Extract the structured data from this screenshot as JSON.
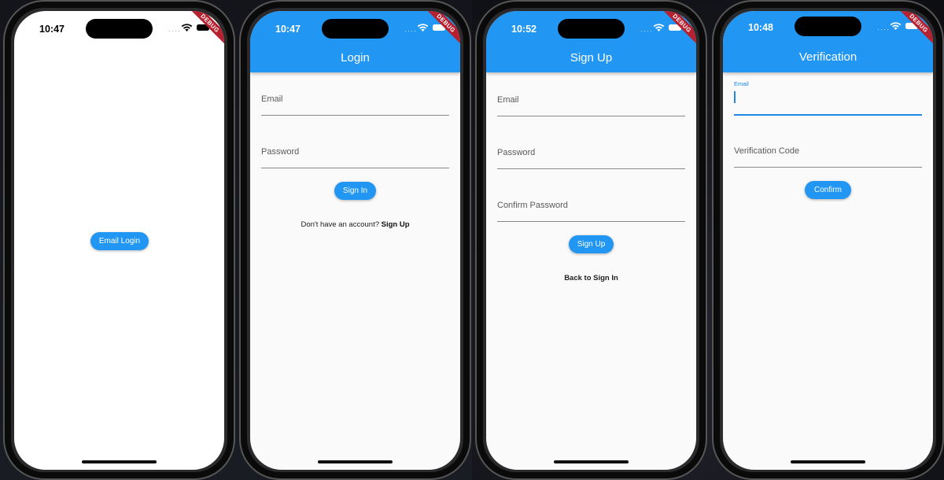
{
  "screens": [
    {
      "status_time": "10:47",
      "debug_label": "DEBUG",
      "button_label": "Email Login"
    },
    {
      "status_time": "10:47",
      "debug_label": "DEBUG",
      "title": "Login",
      "email_label": "Email",
      "password_label": "Password",
      "button_label": "Sign In",
      "signup_prompt": "Don't have an account?",
      "signup_link": "Sign Up"
    },
    {
      "status_time": "10:52",
      "debug_label": "DEBUG",
      "title": "Sign Up",
      "email_label": "Email",
      "password_label": "Password",
      "confirm_label": "Confirm Password",
      "button_label": "Sign Up",
      "back_link": "Back to Sign In"
    },
    {
      "status_time": "10:48",
      "debug_label": "DEBUG",
      "title": "Verification",
      "email_label": "Email",
      "code_label": "Verification Code",
      "button_label": "Confirm"
    }
  ],
  "colors": {
    "primary": "#2196f3",
    "debug_banner": "#b7202f",
    "focus_underline": "#1e88e5"
  },
  "icons": [
    "signal-dots-icon",
    "wifi-icon",
    "battery-icon"
  ]
}
